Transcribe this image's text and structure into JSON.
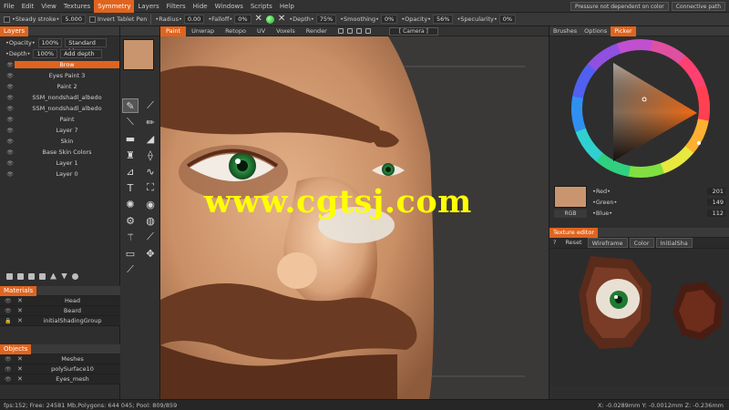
{
  "menubar": {
    "items": [
      "File",
      "Edit",
      "View",
      "Textures",
      "Symmetry",
      "Layers",
      "Filters",
      "Hide",
      "Windows",
      "Scripts",
      "Help"
    ],
    "active_index": 4,
    "right_fields": [
      "Pressure not dependent on color",
      "Connective path"
    ]
  },
  "toolbar": {
    "steady_label": "•Steady stroke•",
    "steady_value": "5.000",
    "invert_label": "Invert Tablet Pen",
    "radius_label": "•Radius•",
    "radius_value": "0.00",
    "falloff_label": "•Falloff•",
    "falloff_value": "0%",
    "depth_label": "•Depth•",
    "depth_value": "75%",
    "smoothing_label": "•Smoothing•",
    "smoothing_value": "0%",
    "opacity_label": "•Opacity•",
    "opacity_value": "56%",
    "specularity_label": "•Specularity•",
    "specularity_value": "0%"
  },
  "layers_panel": {
    "tab": "Layers",
    "opacity_label": "•Opacity•",
    "opacity_value": "100%",
    "blend_mode": "Standard ble",
    "depth_label": "•Depth•",
    "depth_value": "100%",
    "add_depth": "Add depth",
    "layers": [
      "Brow",
      "Eyes Paint 3",
      "Paint 2",
      "SSM_nondshadl_albedo",
      "SSM_nondshadl_albedo",
      "Paint",
      "Layer 7",
      "Skin",
      "Base Skin Colors",
      "Layer 1",
      "Layer 0"
    ],
    "selected_index": 0
  },
  "materials_panel": {
    "tab": "Materials",
    "items": [
      "Head",
      "Beard",
      "initialShadingGroup"
    ]
  },
  "objects_panel": {
    "tab": "Objects",
    "items": [
      "Meshes",
      "polySurface10",
      "Eyes_mesh"
    ]
  },
  "viewport": {
    "tabs": [
      "Paint",
      "Unwrap",
      "Retopo",
      "UV",
      "Voxels",
      "Render"
    ],
    "active_index": 0,
    "camera": "[ Camera ]",
    "watermark": "www.cgtsj.com"
  },
  "right_panel": {
    "tabs": [
      "Brushes",
      "Options",
      "Picker"
    ],
    "active_index": 2,
    "red_label": "•Red•",
    "red_value": "201",
    "green_label": "•Green•",
    "green_value": "149",
    "blue_label": "•Blue•",
    "blue_value": "112",
    "color_mode": "RGB",
    "swatch_color": "#c9956f"
  },
  "texture_editor": {
    "tab": "Texture editor",
    "help": "?",
    "reset": "Reset",
    "wireframe": "Wireframe",
    "color_select": "Color",
    "shader_select": "InitialSha"
  },
  "status": {
    "left": "fps:152;  Free: 24581 Mb,Polygons: 644 045; Pool: 809/859",
    "right": "X: -0.0289mm  Y: -0.0012mm  Z: -0.236mm"
  },
  "colors": {
    "accent": "#e0641e",
    "watermark": "#ffff00"
  }
}
